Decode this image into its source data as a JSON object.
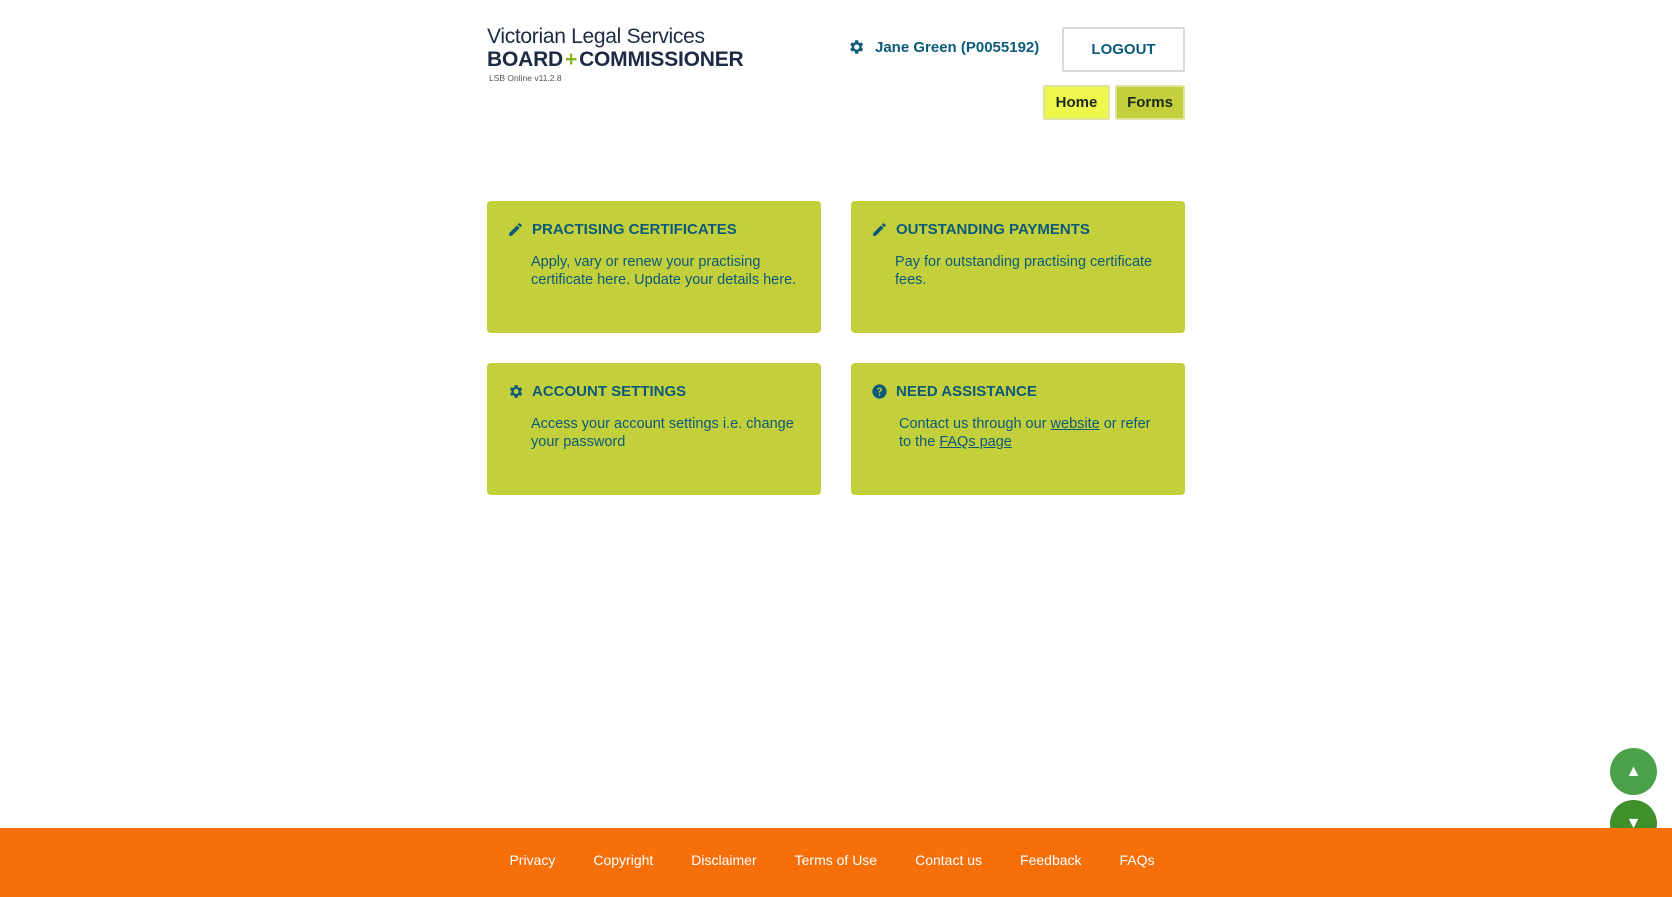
{
  "header": {
    "logo_line1": "Victorian Legal Services",
    "logo_board": "BOARD",
    "logo_plus": "+",
    "logo_commissioner": "COMMISSIONER",
    "version": "LSB Online v11.2.8",
    "user_name": "Jane Green (P0055192)",
    "user_icon": "gear-icon",
    "logout_label": "LOGOUT"
  },
  "nav": {
    "home_label": "Home",
    "forms_label": "Forms"
  },
  "tiles": [
    {
      "icon": "pencil-icon",
      "title": "PRACTISING CERTIFICATES",
      "description": "Apply, vary or renew your practising certificate here. Update your details here."
    },
    {
      "icon": "pencil-icon",
      "title": "OUTSTANDING PAYMENTS",
      "description": "Pay for outstanding practising certificate fees."
    },
    {
      "icon": "gear-icon",
      "title": "ACCOUNT SETTINGS",
      "description": "Access your account settings i.e. change your password"
    },
    {
      "icon": "question-circle-icon",
      "title": "NEED ASSISTANCE",
      "desc_part1": "Contact us through our ",
      "link_website": "website",
      "desc_part2": " or refer to the ",
      "link_faqs": "FAQs page"
    }
  ],
  "scroll": {
    "up_glyph": "▲",
    "down_glyph": "▼"
  },
  "footer": {
    "links": [
      "Privacy",
      "Copyright",
      "Disclaimer",
      "Terms of Use",
      "Contact us",
      "Feedback",
      "FAQs"
    ]
  },
  "colors": {
    "tile_bg": "#c4d03b",
    "text_blue": "#0b5a7a",
    "footer_bg": "#f5700a",
    "home_bg": "#eef74b"
  }
}
